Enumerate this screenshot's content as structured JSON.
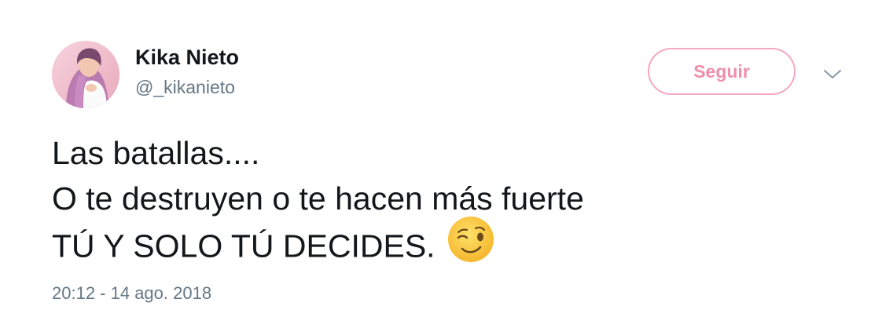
{
  "user": {
    "display_name": "Kika Nieto",
    "handle": "@_kikanieto",
    "avatar_icon": "profile-photo"
  },
  "follow_button": {
    "label": "Seguir"
  },
  "menu": {
    "caret_icon": "chevron-down-icon"
  },
  "tweet": {
    "lines": [
      "Las batallas....",
      "O te destruyen o te hacen más fuerte",
      "TÚ Y SOLO TÚ DECIDES."
    ],
    "emoji_icon": "winking-face-emoji"
  },
  "timestamp": "20:12 - 14 ago. 2018",
  "colors": {
    "accent_pink": "#f08eab",
    "button_border": "#f4a8bf",
    "text_primary": "#14171a",
    "text_secondary": "#657786"
  }
}
